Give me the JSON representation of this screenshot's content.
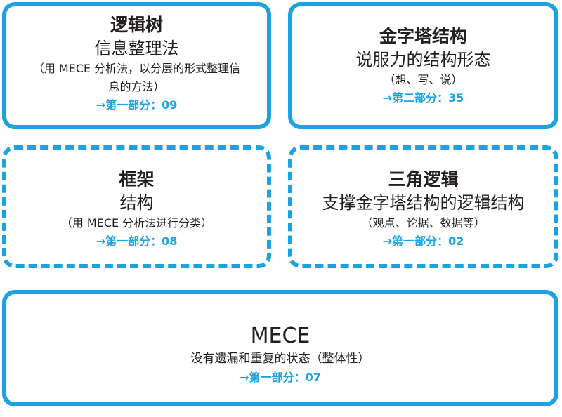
{
  "accent_color": "#1aa3e0",
  "boxes": [
    {
      "border": "solid",
      "title": "逻辑树",
      "subtitle": "信息整理法",
      "note": "（用 MECE 分析法，以分层的形式整理信息的方法）",
      "ref": "→第一部分：09"
    },
    {
      "border": "solid",
      "title": "金字塔结构",
      "subtitle": "说服力的结构形态",
      "note": "（想、写、说）",
      "ref": "→第二部分：35"
    },
    {
      "border": "dashed",
      "title": "框架",
      "subtitle": "结构",
      "note": "（用 MECE 分析法进行分类）",
      "ref": "→第一部分：08"
    },
    {
      "border": "dashed",
      "title": "三角逻辑",
      "subtitle": "支撑金字塔结构的逻辑结构",
      "note": "（观点、论据、数据等）",
      "ref": "→第一部分：02"
    },
    {
      "border": "solid",
      "title": "MECE",
      "note": "没有遗漏和重复的状态（整体性）",
      "ref": "→第一部分：07"
    }
  ]
}
